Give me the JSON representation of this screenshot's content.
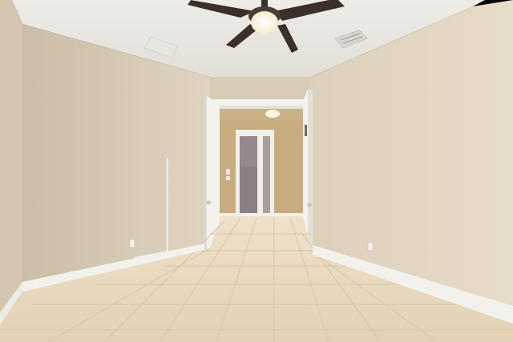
{
  "image": {
    "watermark_text": "",
    "colors": {
      "ceiling": "#ebe9e4",
      "wall_left": "#dccfbb",
      "wall_right": "#e3d7c3",
      "wall_far": "#d9cdb8",
      "hall_wall": "#c9ae82",
      "floor_tile": "#e8d9c0",
      "grout": "#d4c4a8",
      "trim": "#f4f3ef",
      "door": "#f2f1ee",
      "fan_blade": "#3b2f2a",
      "fan_light": "#fffbe8",
      "vent": "#d2d0cb",
      "glass": "#8d7f84"
    }
  }
}
